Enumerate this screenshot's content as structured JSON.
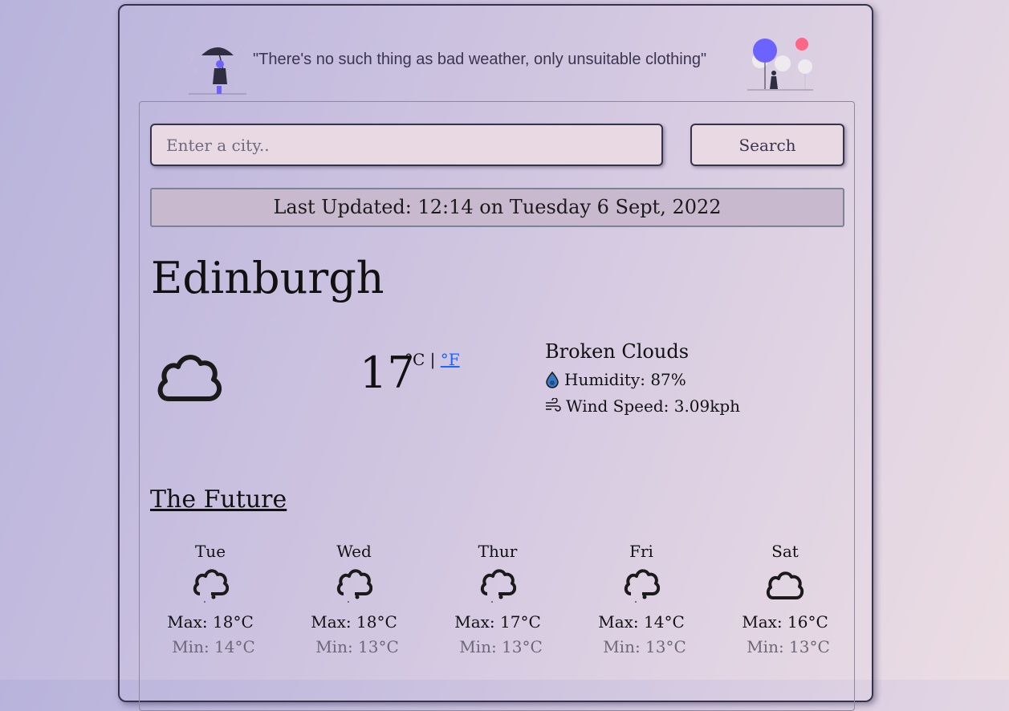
{
  "header": {
    "quote": "\"There's no such thing as bad weather, only unsuitable clothing\""
  },
  "search": {
    "placeholder": "Enter a city..",
    "value": "",
    "button_label": "Search"
  },
  "status": {
    "last_updated": "Last Updated: 12:14 on Tuesday 6 Sept, 2022"
  },
  "current": {
    "city": "Edinburgh",
    "temperature": "17",
    "unit_c": "°C",
    "separator": "|",
    "unit_f": "°F",
    "icon": "cloud-icon",
    "description": "Broken Clouds",
    "humidity": "Humidity: 87%",
    "wind": "Wind Speed: 3.09kph"
  },
  "forecast": {
    "title": "The Future",
    "days": [
      {
        "day": "Tue",
        "icon": "cloud-rain-icon",
        "max": "Max: 18°C",
        "min": "Min: 14°C"
      },
      {
        "day": "Wed",
        "icon": "cloud-rain-icon",
        "max": "Max: 18°C",
        "min": "Min: 13°C"
      },
      {
        "day": "Thur",
        "icon": "cloud-rain-icon",
        "max": "Max: 17°C",
        "min": "Min: 13°C"
      },
      {
        "day": "Fri",
        "icon": "cloud-rain-icon",
        "max": "Max: 14°C",
        "min": "Min: 13°C"
      },
      {
        "day": "Sat",
        "icon": "cloud-icon",
        "max": "Max: 16°C",
        "min": "Min: 13°C"
      }
    ]
  },
  "colors": {
    "accent": "#6c63ff",
    "link": "#1a66ff",
    "border": "#34334a",
    "input_bg": "#e8d9e2",
    "status_bg": "#c8b9cf"
  }
}
